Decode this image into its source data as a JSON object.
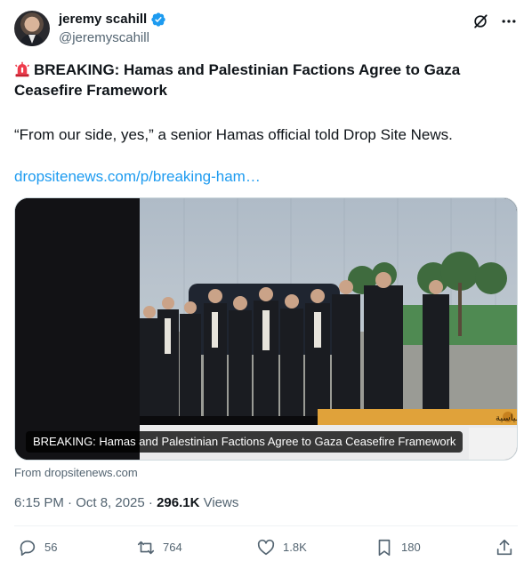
{
  "author": {
    "name": "jeremy scahill",
    "handle": "@jeremyscahill",
    "verified": true,
    "avatar_icon": "avatar-icon"
  },
  "header_icons": [
    "grok-icon",
    "more-icon"
  ],
  "post": {
    "emoji_icon": "siren-icon",
    "title": "BREAKING: Hamas and Palestinian Factions Agree to Gaza Ceasefire Framework",
    "quote": "“From our side, yes,” a senior Hamas official told Drop Site News.",
    "link": "dropsitenews.com/p/breaking-ham…"
  },
  "card": {
    "caption": "BREAKING: Hamas and Palestinian Factions Agree to Gaza Ceasefire Framework",
    "from": "From dropsitenews.com",
    "ticker_text": "الناصرة - د. سهيل دياب - أستاذ العلوم السياسية"
  },
  "meta": {
    "time": "6:15 PM · Oct 8, 2025 · ",
    "views_count": "296.1K",
    "views_label": " Views"
  },
  "actions": {
    "replies": "56",
    "reposts": "764",
    "likes": "1.8K",
    "bookmarks": "180"
  },
  "colors": {
    "accent": "#1d9bf0",
    "secondary_text": "#536471",
    "primary_text": "#0f1419"
  }
}
